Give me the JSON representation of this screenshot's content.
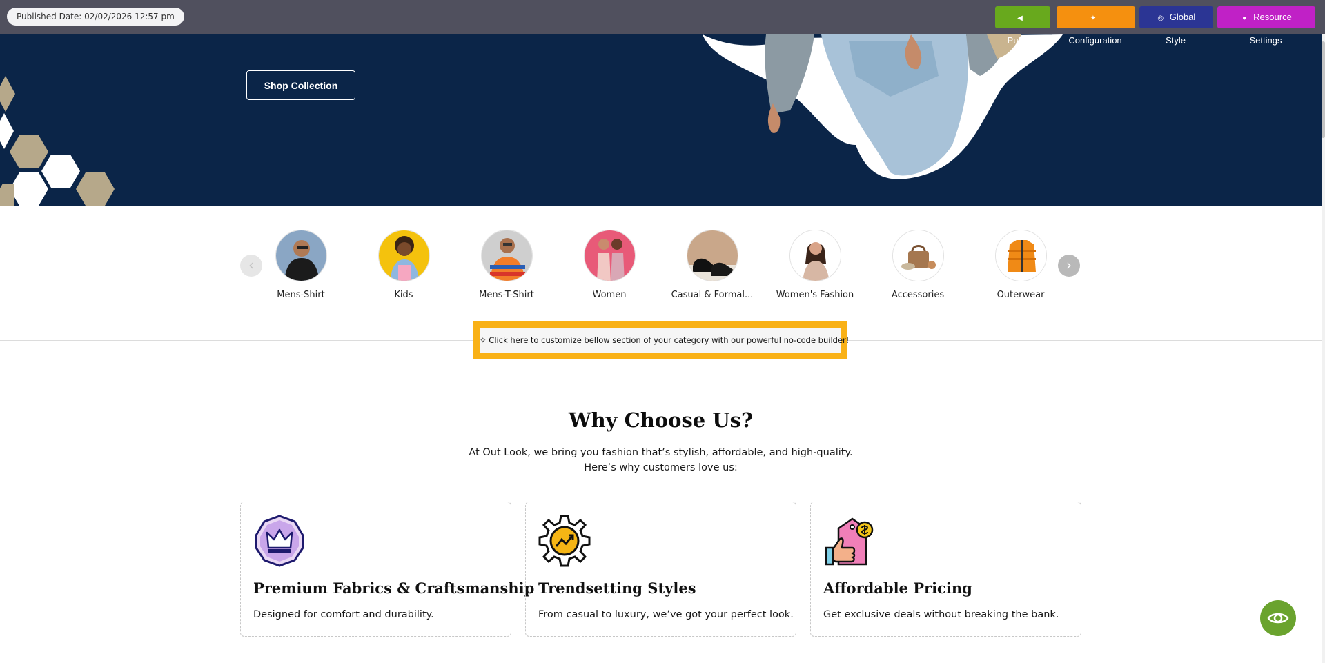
{
  "topbar": {
    "published_date": "Published Date: 02/02/2026 12:57 pm",
    "buttons": {
      "publish": "Publish",
      "configuration": "Configuration",
      "global_style": "Global Style",
      "resource_settings": "Resource Settings"
    },
    "colors": {
      "bar": "#50505e",
      "publish": "#68a91d",
      "configuration": "#f5900f",
      "global_style": "#2b3594",
      "resource_settings": "#c021c6"
    }
  },
  "hero": {
    "cta_label": "Shop Collection",
    "background_color": "#0b2548"
  },
  "categories": {
    "prev_icon": "‹",
    "next_icon": "›",
    "items": [
      {
        "label": "Mens-Shirt"
      },
      {
        "label": "Kids"
      },
      {
        "label": "Mens-T-Shirt"
      },
      {
        "label": "Women"
      },
      {
        "label": "Casual & Formal..."
      },
      {
        "label": "Women's Fashion"
      },
      {
        "label": "Accessories"
      },
      {
        "label": "Outerwear"
      }
    ]
  },
  "builder_prompt": {
    "text": "✧ Click here to customize bellow section of your category with our powerful no-code builder!",
    "border_color": "#f9b116"
  },
  "why_choose_us": {
    "title": "Why Choose Us?",
    "subtitle_line1": "At Out Look, we bring you fashion that’s stylish, affordable, and high-quality.",
    "subtitle_line2": "Here’s why customers love us:",
    "features": [
      {
        "icon": "crown-icon",
        "title": "Premium Fabrics & Craftsmanship",
        "text": "Designed for comfort and durability."
      },
      {
        "icon": "gear-trend-icon",
        "title": "Trendsetting Styles",
        "text": "From casual to luxury, we’ve got your perfect look."
      },
      {
        "icon": "price-tag-icon",
        "title": "Affordable Pricing",
        "text": "Get exclusive deals without breaking the bank."
      }
    ]
  },
  "preview_button": {
    "icon": "eye-icon",
    "color": "#6aa32e"
  }
}
